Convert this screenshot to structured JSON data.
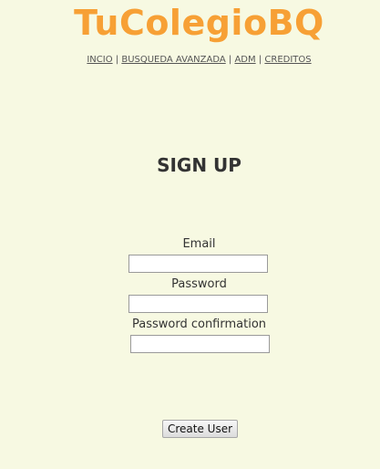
{
  "header": {
    "brand": "TuColegioBQ",
    "nav": {
      "inicio": "INCIO",
      "busqueda": "BUSQUEDA AVANZADA",
      "adm": "ADM",
      "creditos": "CREDITOS",
      "separator": "|"
    }
  },
  "form": {
    "title": "SIGN UP",
    "email_label": "Email",
    "email_value": "",
    "password_label": "Password",
    "password_value": "",
    "password_confirmation_label": "Password confirmation",
    "password_confirmation_value": "",
    "submit_label": "Create User"
  },
  "colors": {
    "background": "#f7f9e2",
    "brand": "#f7a035",
    "text": "#333333"
  }
}
